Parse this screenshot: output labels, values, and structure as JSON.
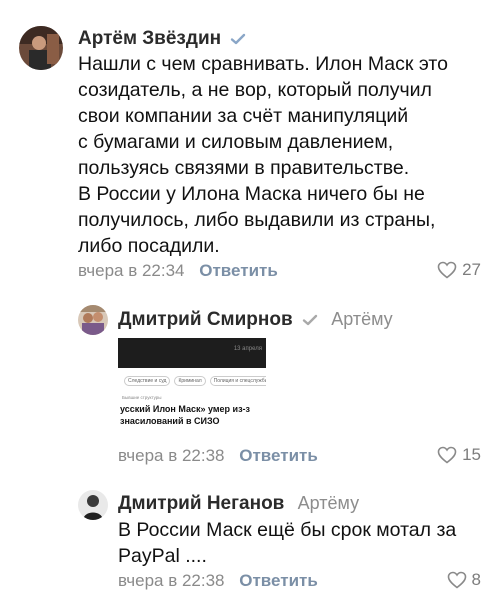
{
  "comments": [
    {
      "author": "Артём Звёздин",
      "verified": true,
      "text_lines": [
        "Нашли с чем сравнивать. Илон Маск это",
        "созидатель, а не вор, который получил",
        "свои компании за счёт манипуляций",
        "с бумагами и силовым давлением,",
        "пользуясь связями в правительстве.",
        "В России у Илона Маска ничего бы не",
        "получилось, либо выдавили из страны,",
        "либо посадили."
      ],
      "time": "вчера в 22:34",
      "reply_label": "Ответить",
      "likes": "27"
    },
    {
      "author": "Дмитрий Смирнов",
      "verified": true,
      "reply_to": "Артёму",
      "attachment": {
        "header_date": "13 апреля",
        "tabs": [
          "Следствие и суд",
          "Криминал",
          "Полиция и спецслужбы"
        ],
        "category": "Бывшие структуры",
        "title_lines": [
          "усский Илон Маск» умер из-з",
          "знасилований в СИЗО"
        ]
      },
      "time": "вчера в 22:38",
      "reply_label": "Ответить",
      "likes": "15"
    },
    {
      "author": "Дмитрий Неганов",
      "verified": false,
      "reply_to": "Артёму",
      "text_lines": [
        "В России Маск ещё бы срок мотал за",
        "PayPal ...."
      ],
      "time": "вчера в 22:38",
      "reply_label": "Ответить",
      "likes": "8"
    }
  ],
  "colors": {
    "verified": "#8aa6c7",
    "reply": "#7b8fa6",
    "meta": "#8a8a8a"
  }
}
